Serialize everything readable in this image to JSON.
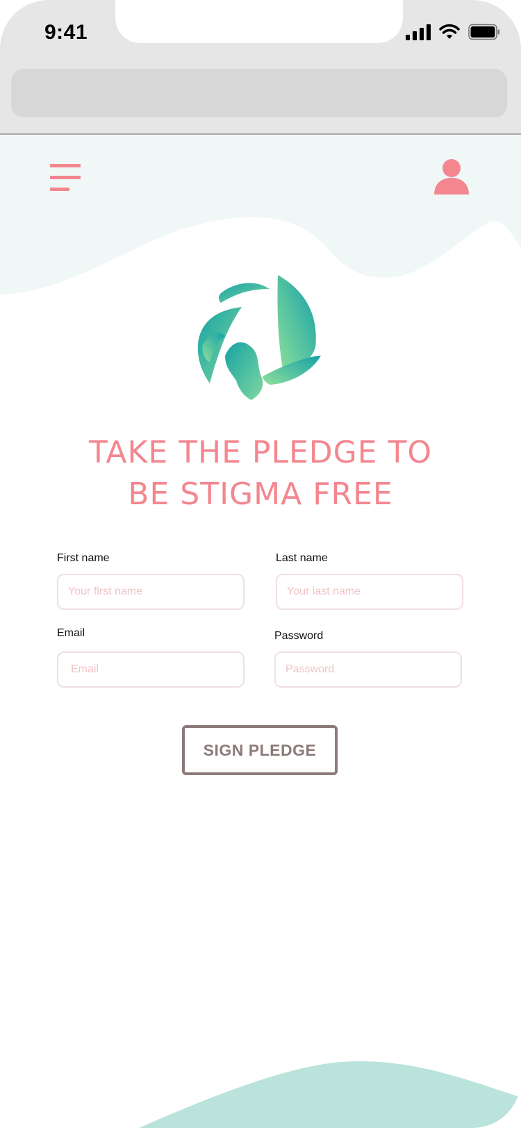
{
  "status_bar": {
    "time": "9:41",
    "icons": [
      "signal-icon",
      "wifi-icon",
      "battery-icon"
    ]
  },
  "browser": {
    "url_value": ""
  },
  "header": {
    "menu_icon": "hamburger-menu-icon",
    "account_icon": "user-icon"
  },
  "colors": {
    "accent_pink": "#f4868f",
    "header_mint": "#f0f8f7",
    "bottom_wave_teal": "#b9e3db",
    "button_border": "#8c7a7a",
    "input_border": "#f0dfe2",
    "placeholder": "#f2c3c7"
  },
  "hero": {
    "logo_icon": "leaf-circle-logo-icon",
    "title_line1": "TAKE THE PLEDGE TO",
    "title_line2": "BE STIGMA FREE"
  },
  "form": {
    "first_name": {
      "label": "First name",
      "placeholder": "Your first name",
      "value": ""
    },
    "last_name": {
      "label": "Last name",
      "placeholder": "Your last name",
      "value": ""
    },
    "email": {
      "label": "Email",
      "placeholder": "Email",
      "value": ""
    },
    "password": {
      "label": "Password",
      "placeholder": "Password",
      "value": ""
    },
    "submit_label": "SIGN PLEDGE"
  }
}
